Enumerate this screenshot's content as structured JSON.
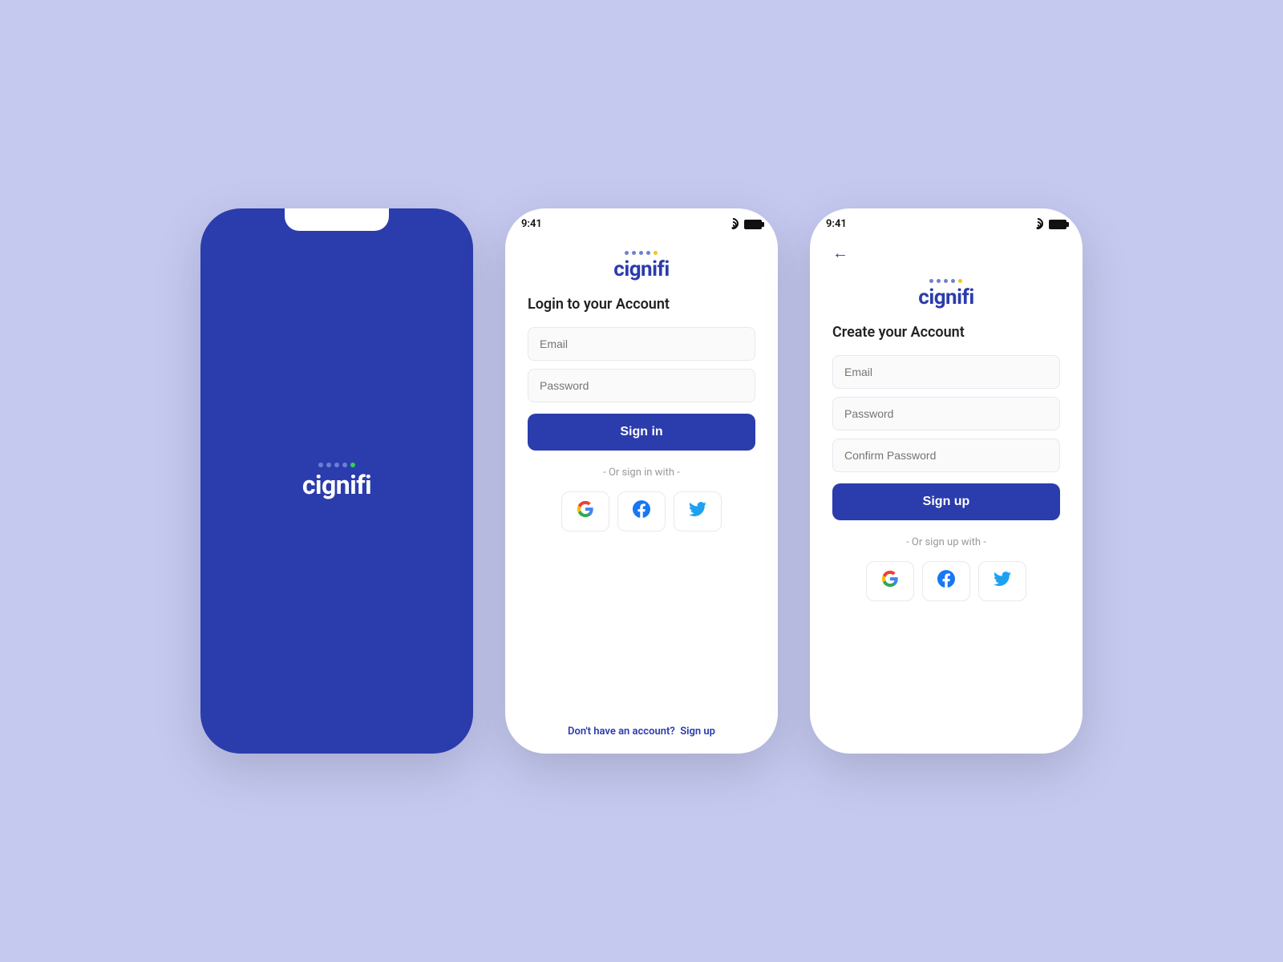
{
  "bg_color": "#c5c9f0",
  "brand_color": "#2b3cac",
  "splash": {
    "logo_text": "cignifi",
    "dot_colors": [
      "#8b9edc",
      "#8b9edc",
      "#8b9edc",
      "#8b9edc",
      "#34d058"
    ]
  },
  "login": {
    "time": "9:41",
    "title": "Login to your Account",
    "email_placeholder": "Email",
    "password_placeholder": "Password",
    "sign_in_label": "Sign in",
    "divider": "- Or sign in with -",
    "footer_text": "Don't have an account?",
    "footer_link": "Sign up"
  },
  "register": {
    "time": "9:41",
    "title": "Create your Account",
    "email_placeholder": "Email",
    "password_placeholder": "Password",
    "confirm_password_placeholder": "Confirm Password",
    "sign_up_label": "Sign up",
    "divider": "- Or sign up with -"
  },
  "logo_dots": [
    "#8b9edc",
    "#8b9edc",
    "#8b9edc",
    "#8b9edc",
    "#f5c518"
  ]
}
